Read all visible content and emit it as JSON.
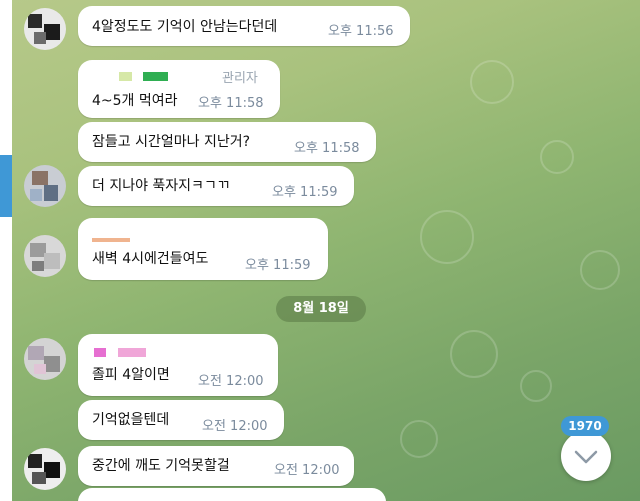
{
  "colors": {
    "accent": "#3f98d6",
    "bubble": "#ffffff",
    "time_text": "#7b8b9d"
  },
  "messages": [
    {
      "text": "4알정도도 기억이 안남는다던데",
      "time": "오후 11:56"
    },
    {
      "text": "4~5개 먹여라",
      "time": "오후 11:58",
      "badge": "관리자"
    },
    {
      "text": "잠들고 시간얼마나 지난거?",
      "time": "오후 11:58"
    },
    {
      "text": "더 지나야 푹자지ㅋㄱㄲ",
      "time": "오후 11:59"
    },
    {
      "text": "새벽 4시에건들여도",
      "time": "오후 11:59"
    },
    {
      "text": "졸피 4알이면",
      "time": "오전 12:00"
    },
    {
      "text": "기억없을텐데",
      "time": "오전 12:00"
    },
    {
      "text": "중간에 깨도 기억못할걸",
      "time": "오전 12:00"
    }
  ],
  "date_divider": "8월 18일",
  "scroll_down": {
    "unread_count": "1970",
    "icon": "chevron-down-icon"
  }
}
